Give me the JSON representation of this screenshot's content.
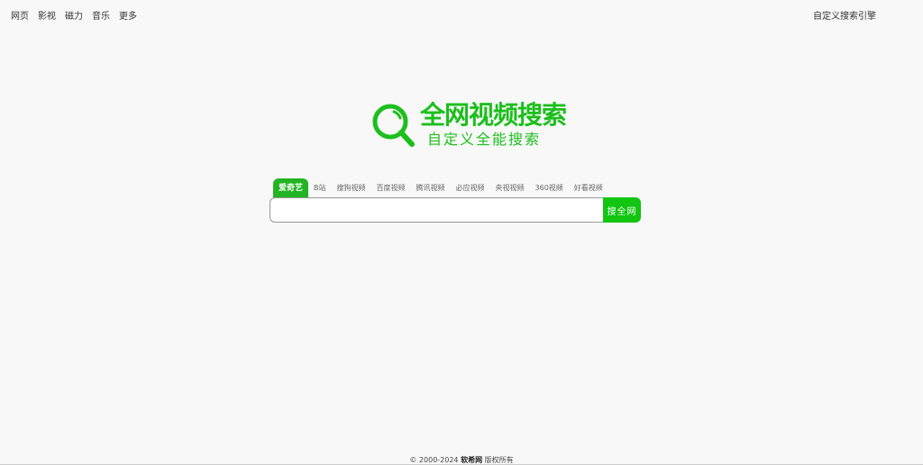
{
  "nav": {
    "items": [
      "网页",
      "影视",
      "磁力",
      "音乐",
      "更多"
    ],
    "right_link": "自定义搜索引擎"
  },
  "logo": {
    "title": "全网视频搜索",
    "subtitle": "自定义全能搜索",
    "icon": "search-magnifier-icon",
    "color": "#1cbf1c"
  },
  "engines": {
    "tabs": [
      "爱奇艺",
      "B站",
      "搜狗视频",
      "百度视频",
      "腾讯视频",
      "必应视频",
      "央视视频",
      "360视频",
      "好看视频"
    ],
    "active": "爱奇艺"
  },
  "search": {
    "value": "",
    "placeholder": "",
    "button_label": "搜全网",
    "accent": "#11c511"
  },
  "footer": {
    "copyright": "© 2000-2024",
    "site": "软希网",
    "rights": "版权所有"
  }
}
